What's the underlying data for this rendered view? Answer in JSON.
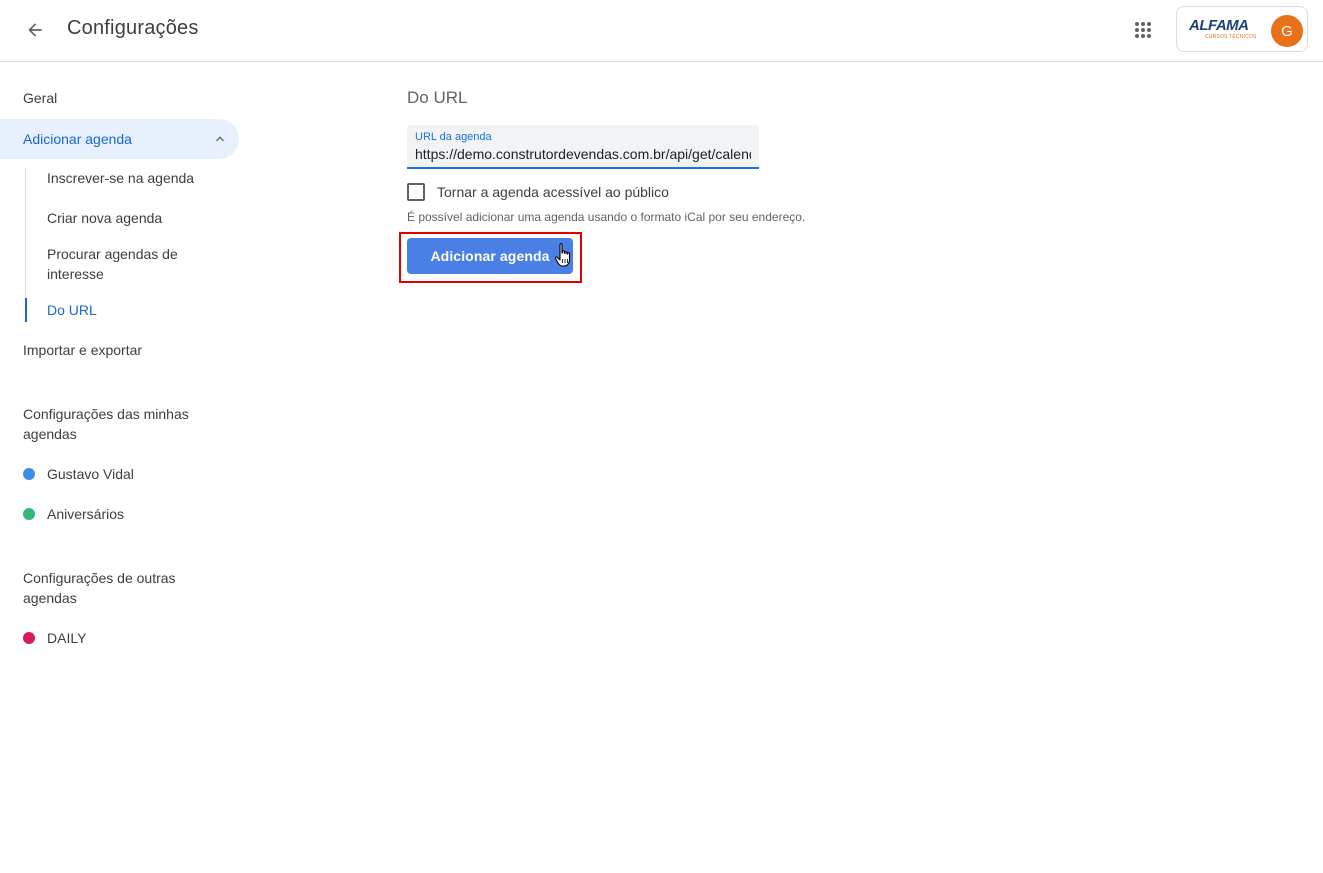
{
  "header": {
    "title": "Configurações",
    "back_icon": "arrow-back-icon",
    "apps_icon": "apps-grid-icon",
    "brand": {
      "name": "ALFAMA",
      "tagline": "CURSOS TÉCNICOS"
    },
    "avatar_initial": "G"
  },
  "sidebar": {
    "general": "Geral",
    "add_calendar": "Adicionar agenda",
    "sub_items": [
      "Inscrever-se na agenda",
      "Criar nova agenda",
      "Procurar agendas de interesse",
      "Do URL"
    ],
    "import_export": "Importar e exportar",
    "my_calendars_heading": "Configurações das minhas agendas",
    "my_calendars": [
      {
        "name": "Gustavo Vidal",
        "color": "#3a8ee6"
      },
      {
        "name": "Aniversários",
        "color": "#33b679"
      }
    ],
    "other_calendars_heading": "Configurações de outras agendas",
    "other_calendars": [
      {
        "name": "DAILY",
        "color": "#d81b60"
      }
    ]
  },
  "main": {
    "section_title": "Do URL",
    "url_field": {
      "label": "URL da agenda",
      "value": "https://demo.construtordevendas.com.br/api/get/calendar"
    },
    "public_checkbox": {
      "label": "Tornar a agenda acessível ao público",
      "checked": false
    },
    "helper_text": "É possível adicionar uma agenda usando o formato iCal por seu endereço.",
    "add_button": "Adicionar agenda"
  },
  "colors": {
    "accent": "#1967d2",
    "button": "#4a7fe5",
    "highlight": "#e00000",
    "avatar": "#e8711a"
  }
}
